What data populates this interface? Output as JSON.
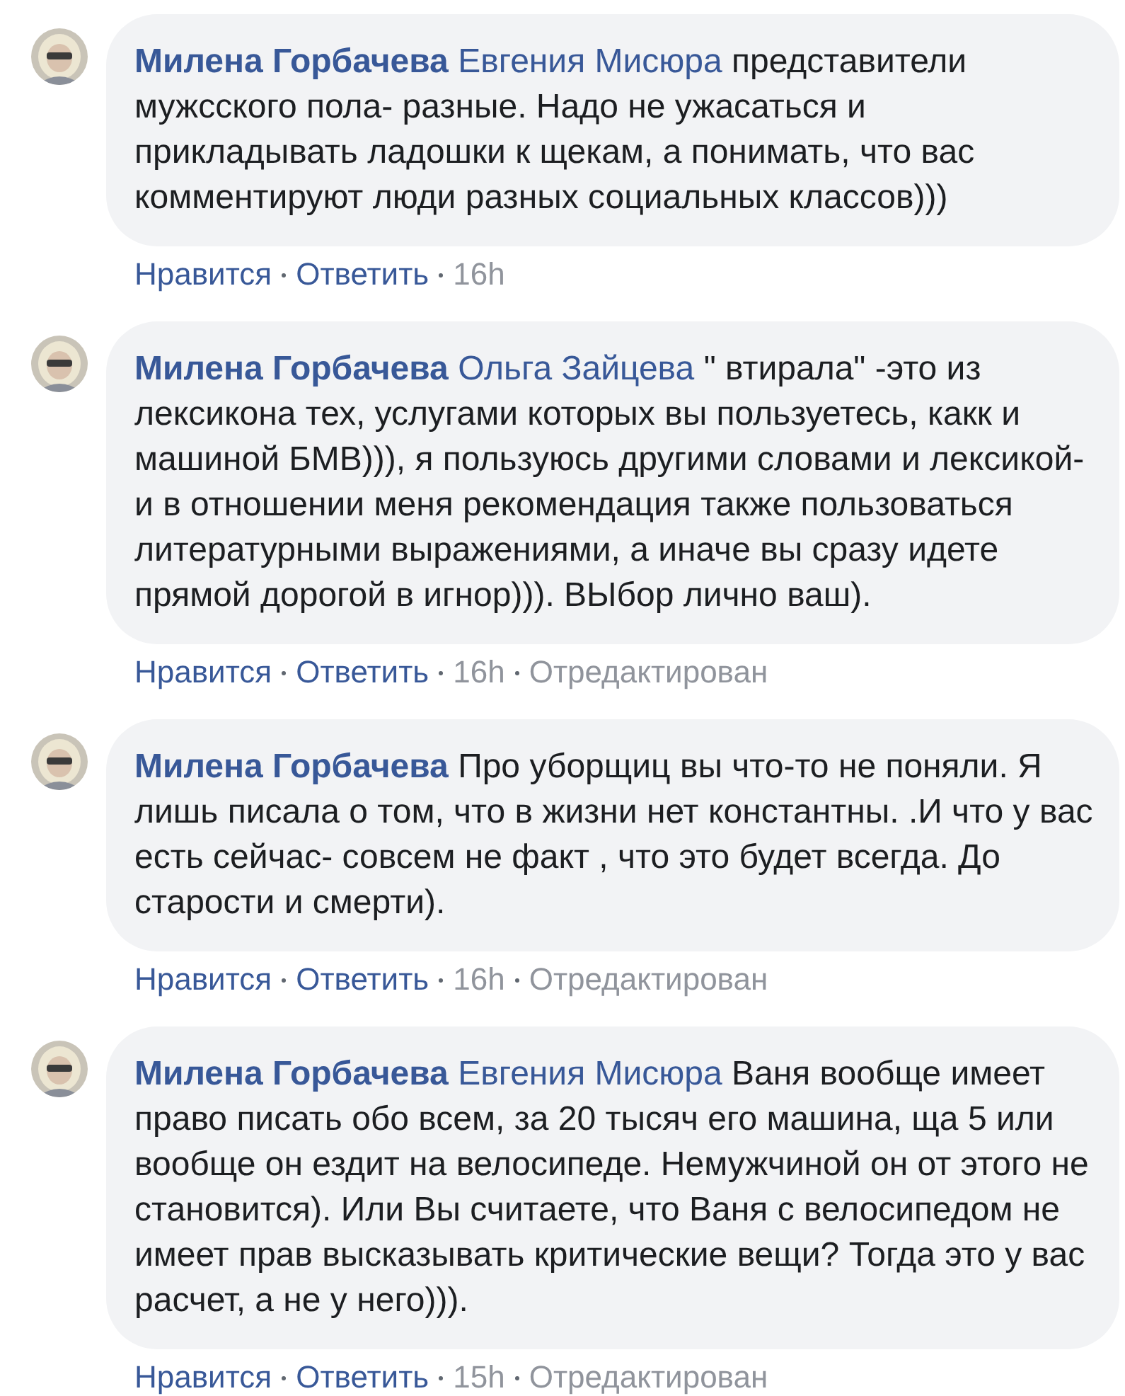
{
  "comments": [
    {
      "author": "Милена Горбачева",
      "mention": "Евгения Мисюра",
      "text": "представители мужсского пола- разные. Надо не ужасаться и прикладывать ладошки к щекам, а понимать, что вас комментируют люди разных социальных классов)))",
      "actions": {
        "like": "Нравится",
        "reply": "Ответить",
        "time": "16h"
      }
    },
    {
      "author": "Милена Горбачева",
      "mention": "Ольга Зайцева",
      "text": "\" втирала\" -это из лексикона тех, услугами которых вы пользуетесь, какк и машиной БМВ))), я пользуюсь другими словами и лексикой- и в отношении меня рекомендация также пользоваться литературными выражениями, а иначе вы сразу идете прямой дорогой в игнор))). ВЫбор лично ваш).",
      "actions": {
        "like": "Нравится",
        "reply": "Ответить",
        "time": "16h",
        "edited": "Отредактирован"
      }
    },
    {
      "author": "Милена Горбачева",
      "text": "Про уборщиц вы что-то не поняли. Я лишь писала о том, что в жизни нет константны. .И что у вас есть сейчас- совсем не факт , что это будет всегда. До старости и смерти).",
      "actions": {
        "like": "Нравится",
        "reply": "Ответить",
        "time": "16h",
        "edited": "Отредактирован"
      }
    },
    {
      "author": "Милена Горбачева",
      "mention": "Евгения Мисюра",
      "text": "Ваня вообще имеет право писать обо всем, за 20 тысяч его машина, ща 5 или вообще он ездит на велосипеде. Немужчиной он от этого не становится). Или Вы считаете, что Ваня с велосипедом не имеет прав высказывать критические вещи? Тогда это у вас расчет, а не у него))).",
      "actions": {
        "like": "Нравится",
        "reply": "Ответить",
        "time": "15h",
        "edited": "Отредактирован"
      }
    }
  ]
}
